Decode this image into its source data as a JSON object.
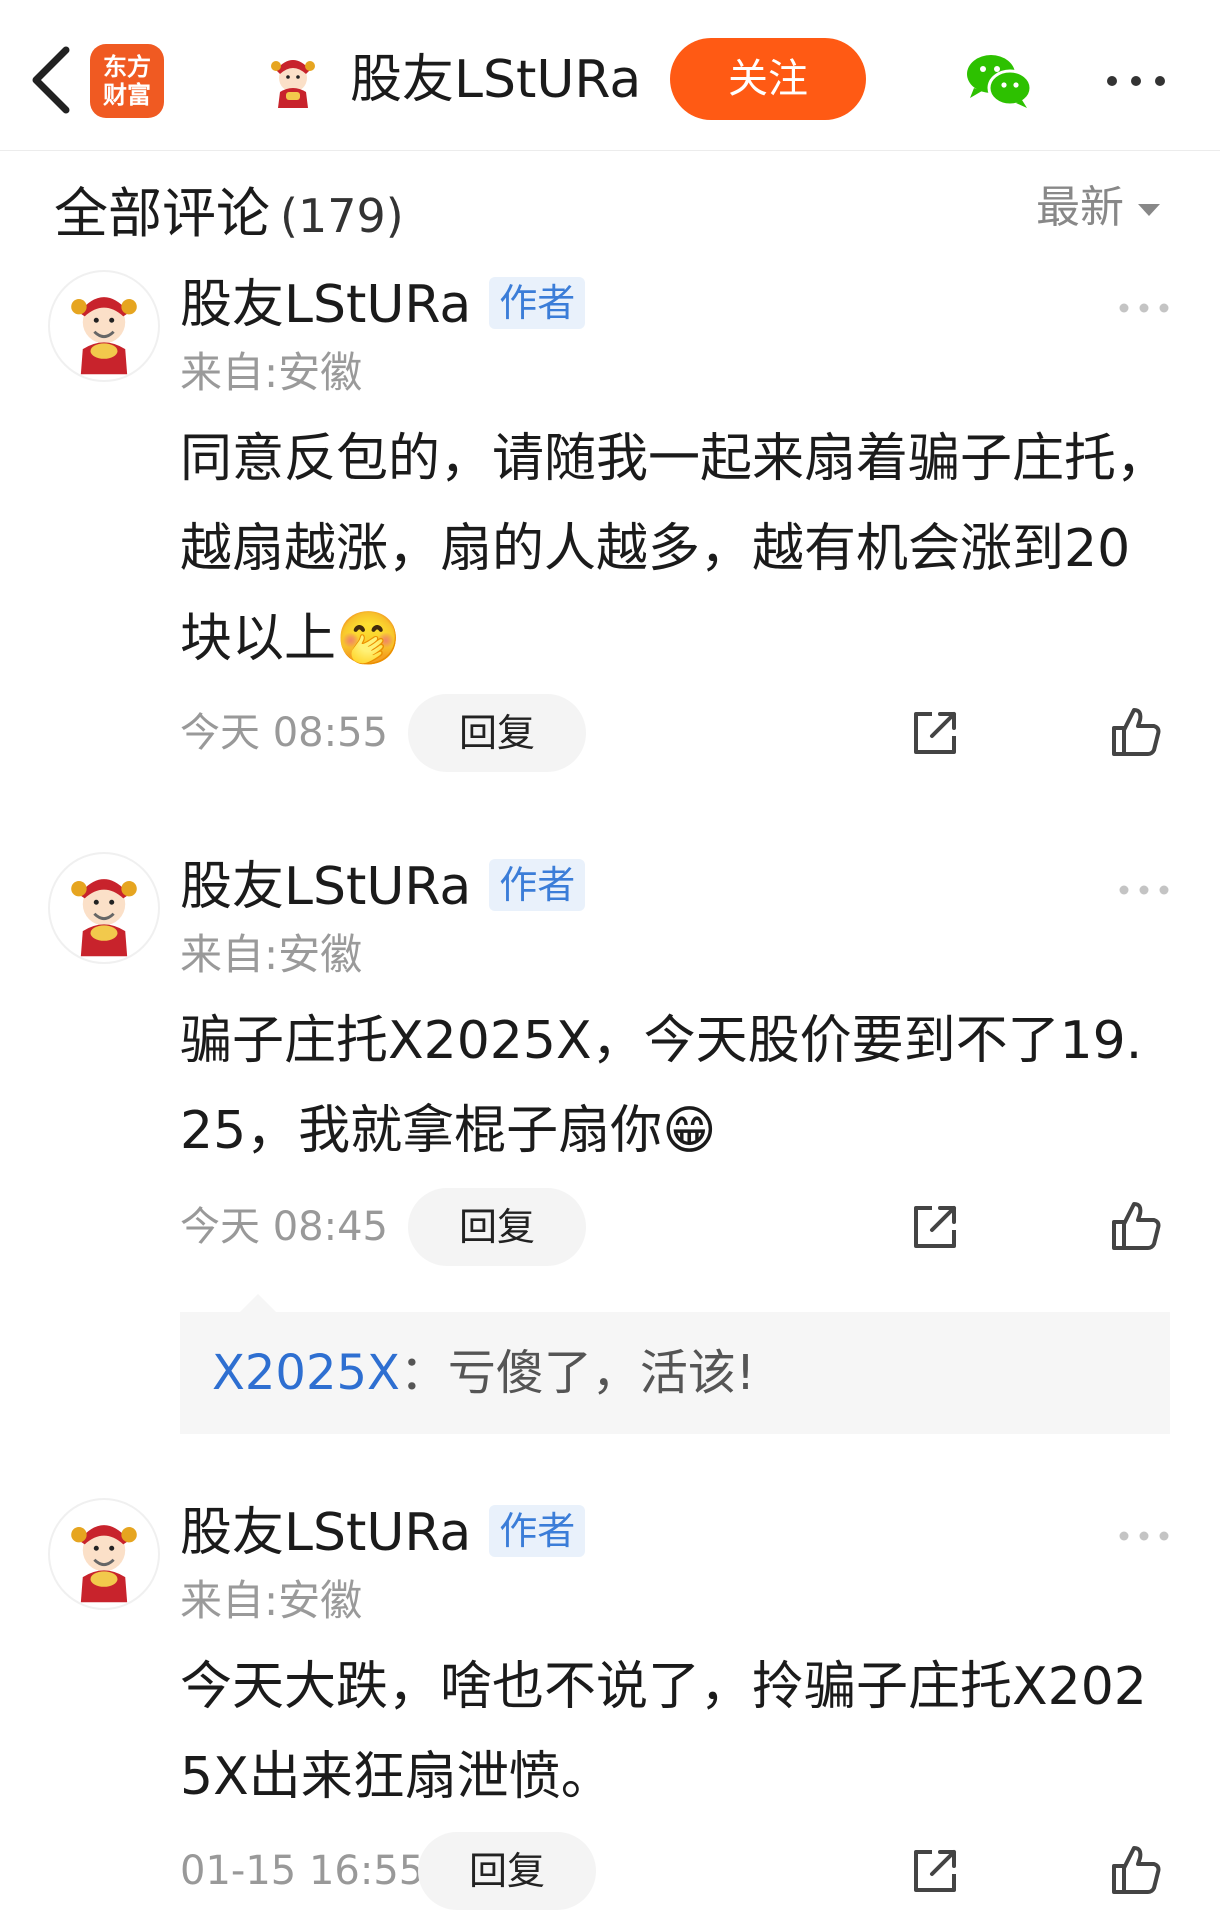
{
  "header": {
    "app_logo_line1": "东方",
    "app_logo_line2": "财富",
    "title": "股友LStURa",
    "follow_label": "关注"
  },
  "comments_section": {
    "title": "全部评论",
    "count": "(179)",
    "sort_label": "最新"
  },
  "comments": [
    {
      "username": "股友LStURa",
      "badge": "作者",
      "location": "来自:安徽",
      "text": "同意反包的，请随我一起来扇着骗子庄托，越扇越涨，扇的人越多，越有机会涨到20块以上",
      "emoji": "🤭",
      "time": "今天 08:55",
      "reply_label": "回复"
    },
    {
      "username": "股友LStURa",
      "badge": "作者",
      "location": "来自:安徽",
      "text": "骗子庄托X2025X，今天股价要到不了19.25，我就拿棍子扇你",
      "emoji": "😁",
      "time": "今天 08:45",
      "reply_label": "回复",
      "quoted_user": "X2025X",
      "quoted_text": "：亏傻了，活该!"
    },
    {
      "username": "股友LStURa",
      "badge": "作者",
      "location": "来自:安徽",
      "text": "今天大跌，啥也不说了，拎骗子庄托X2025X出来狂扇泄愤。",
      "time": "01-15 16:55",
      "reply_label": "回复"
    }
  ],
  "icons": {
    "back": "back-chevron-icon",
    "wechat": "wechat-icon",
    "more": "more-dots-icon",
    "share": "share-icon",
    "like": "thumbs-up-icon"
  },
  "colors": {
    "accent": "#ff5a14",
    "brand": "#f05a22",
    "badge_text": "#3b7dd8",
    "badge_bg": "#e9f1fb",
    "link": "#2e6fd1",
    "wechat": "#2dc100"
  }
}
